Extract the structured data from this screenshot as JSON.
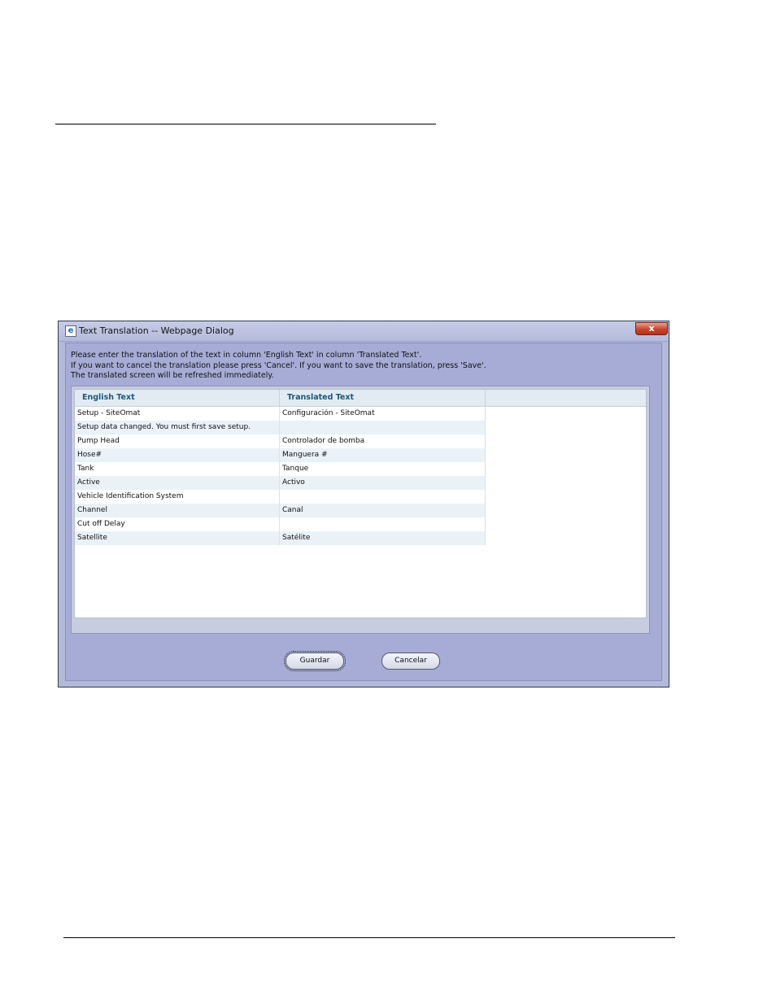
{
  "dialog": {
    "title": "Text Translation -- Webpage Dialog",
    "close_label": "x",
    "icon_glyph": "e",
    "instructions": [
      "Please enter the translation of the text in column 'English Text' in column 'Translated Text'.",
      "If you want to cancel the translation please press 'Cancel'. If you want to save the translation, press 'Save'.",
      "The translated screen will be refreshed immediately."
    ],
    "table": {
      "headers": [
        "English Text",
        "Translated Text"
      ],
      "rows": [
        {
          "english": "Setup - SiteOmat",
          "translated": "Configuración - SiteOmat"
        },
        {
          "english": "Setup data changed. You must first save setup.",
          "translated": ""
        },
        {
          "english": "Pump Head",
          "translated": "Controlador de bomba"
        },
        {
          "english": "Hose#",
          "translated": "Manguera #"
        },
        {
          "english": "Tank",
          "translated": "Tanque"
        },
        {
          "english": "Active",
          "translated": "Activo"
        },
        {
          "english": "Vehicle Identification System",
          "translated": ""
        },
        {
          "english": "Channel",
          "translated": "Canal"
        },
        {
          "english": "Cut off Delay",
          "translated": ""
        },
        {
          "english": "Satellite",
          "translated": "Satélite"
        }
      ]
    },
    "buttons": {
      "save_label": "Guardar",
      "cancel_label": "Cancelar"
    }
  }
}
